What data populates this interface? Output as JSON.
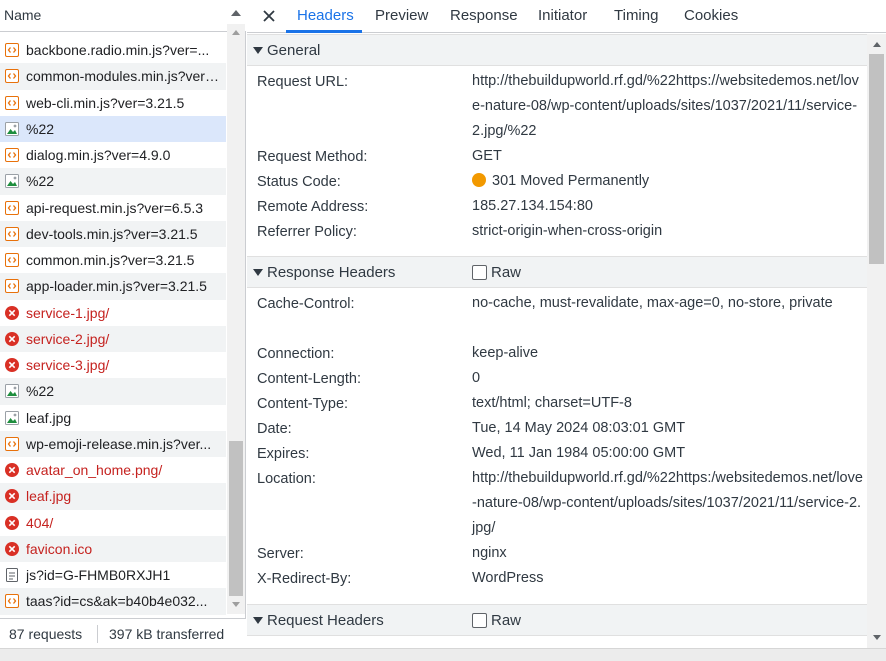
{
  "list": {
    "column_name": "Name",
    "requests": [
      {
        "name": "backbone.radio.min.js?ver=...",
        "type": "script",
        "status": "ok"
      },
      {
        "name": "common-modules.min.js?ver=...",
        "type": "script",
        "status": "ok"
      },
      {
        "name": "web-cli.min.js?ver=3.21.5",
        "type": "script",
        "status": "ok"
      },
      {
        "name": "%22",
        "type": "image",
        "status": "ok",
        "selected": true
      },
      {
        "name": "dialog.min.js?ver=4.9.0",
        "type": "script",
        "status": "ok"
      },
      {
        "name": "%22",
        "type": "image",
        "status": "ok"
      },
      {
        "name": "api-request.min.js?ver=6.5.3",
        "type": "script",
        "status": "ok"
      },
      {
        "name": "dev-tools.min.js?ver=3.21.5",
        "type": "script",
        "status": "ok"
      },
      {
        "name": "common.min.js?ver=3.21.5",
        "type": "script",
        "status": "ok"
      },
      {
        "name": "app-loader.min.js?ver=3.21.5",
        "type": "script",
        "status": "ok"
      },
      {
        "name": "service-1.jpg/",
        "type": "image",
        "status": "error"
      },
      {
        "name": "service-2.jpg/",
        "type": "image",
        "status": "error"
      },
      {
        "name": "service-3.jpg/",
        "type": "image",
        "status": "error"
      },
      {
        "name": "%22",
        "type": "image",
        "status": "ok"
      },
      {
        "name": "leaf.jpg",
        "type": "image",
        "status": "ok"
      },
      {
        "name": "wp-emoji-release.min.js?ver...",
        "type": "script",
        "status": "ok"
      },
      {
        "name": "avatar_on_home.png/",
        "type": "image",
        "status": "error"
      },
      {
        "name": "leaf.jpg",
        "type": "image",
        "status": "error"
      },
      {
        "name": "404/",
        "type": "document",
        "status": "error"
      },
      {
        "name": "favicon.ico",
        "type": "image",
        "status": "error"
      },
      {
        "name": "js?id=G-FHMB0RXJH1",
        "type": "document",
        "status": "ok"
      },
      {
        "name": "taas?id=cs&ak=b40b4e032...",
        "type": "script",
        "status": "ok"
      }
    ],
    "footer": {
      "requests": "87 requests",
      "transferred": "397 kB transferred"
    }
  },
  "tabs": [
    "Headers",
    "Preview",
    "Response",
    "Initiator",
    "Timing",
    "Cookies"
  ],
  "active_tab": "Headers",
  "general": {
    "title": "General",
    "request_url_label": "Request URL:",
    "request_url": "http://thebuildupworld.rf.gd/%22https://websitedemos.net/love-nature-08/wp-content/uploads/sites/1037/2021/11/service-2.jpg/%22",
    "request_method_label": "Request Method:",
    "request_method": "GET",
    "status_code_label": "Status Code:",
    "status_code": "301 Moved Permanently",
    "status_color": "#f29900",
    "remote_address_label": "Remote Address:",
    "remote_address": "185.27.134.154:80",
    "referrer_policy_label": "Referrer Policy:",
    "referrer_policy": "strict-origin-when-cross-origin"
  },
  "response_headers": {
    "title": "Response Headers",
    "raw_label": "Raw",
    "items": [
      {
        "key": "Cache-Control:",
        "value": "no-cache, must-revalidate, max-age=0, no-store, private"
      },
      {
        "key": "Connection:",
        "value": "keep-alive"
      },
      {
        "key": "Content-Length:",
        "value": "0"
      },
      {
        "key": "Content-Type:",
        "value": "text/html; charset=UTF-8"
      },
      {
        "key": "Date:",
        "value": "Tue, 14 May 2024 08:03:01 GMT"
      },
      {
        "key": "Expires:",
        "value": "Wed, 11 Jan 1984 05:00:00 GMT"
      },
      {
        "key": "Location:",
        "value": "http://thebuildupworld.rf.gd/%22https:/websitedemos.net/love-nature-08/wp-content/uploads/sites/1037/2021/11/service-2.jpg/"
      },
      {
        "key": "Server:",
        "value": "nginx"
      },
      {
        "key": "X-Redirect-By:",
        "value": "WordPress"
      }
    ]
  },
  "request_headers": {
    "title": "Request Headers",
    "raw_label": "Raw"
  }
}
